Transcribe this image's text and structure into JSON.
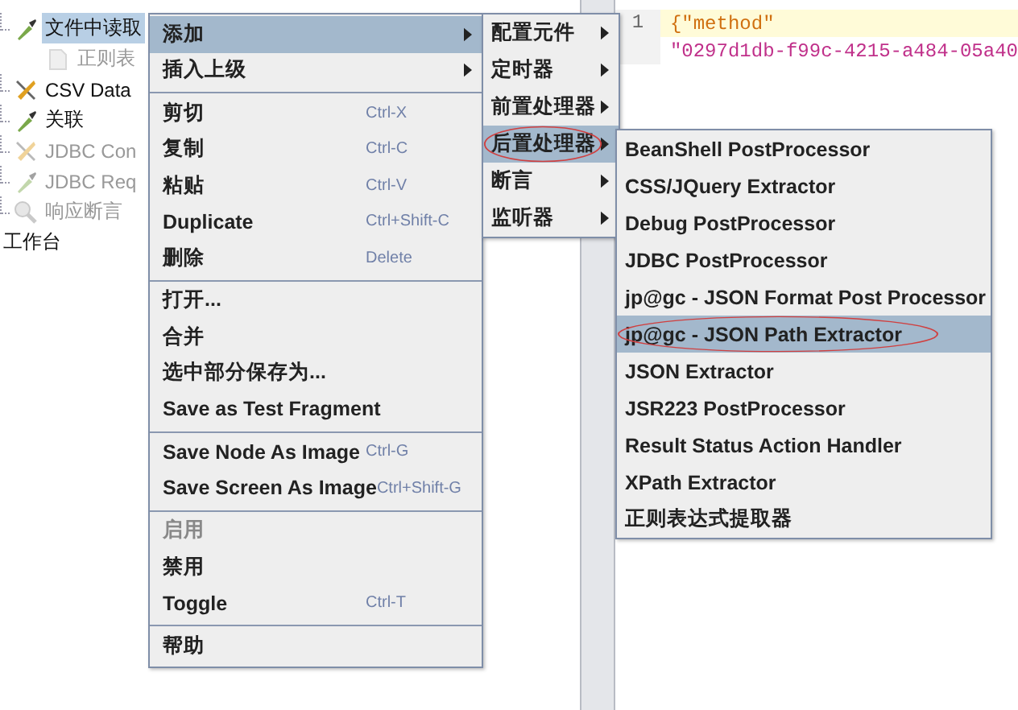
{
  "tree": {
    "items": [
      {
        "label": "文件中读取",
        "kind": "dropper",
        "selected": true,
        "disabled": false,
        "children": [
          {
            "label": "正则表",
            "kind": "page",
            "selected": false,
            "disabled": true
          }
        ]
      },
      {
        "label": "CSV Data",
        "kind": "tools",
        "selected": false,
        "disabled": false
      },
      {
        "label": "关联",
        "kind": "dropper",
        "selected": false,
        "disabled": false
      },
      {
        "label": "JDBC Con",
        "kind": "tools",
        "selected": false,
        "disabled": true
      },
      {
        "label": "JDBC Req",
        "kind": "dropper",
        "selected": false,
        "disabled": true
      },
      {
        "label": "响应断言",
        "kind": "magnifier",
        "selected": false,
        "disabled": true
      }
    ],
    "root": {
      "label": "工作台"
    }
  },
  "editor": {
    "lines": [
      {
        "number": "1",
        "parts": [
          {
            "kind": "key",
            "text": "{\"method\""
          }
        ],
        "current": true
      },
      {
        "parts": [
          {
            "kind": "string",
            "text": "\"0297d1db-f99c-4215-a484-05a40"
          }
        ],
        "current": false
      }
    ]
  },
  "menu": {
    "groups": [
      [
        {
          "label": "添加",
          "submenu": true,
          "selected": true,
          "disabled": false
        },
        {
          "label": "插入上级",
          "submenu": true,
          "selected": false,
          "disabled": false
        }
      ],
      [
        {
          "label": "剪切",
          "shortcut": "Ctrl-X",
          "submenu": false,
          "selected": false,
          "disabled": false
        },
        {
          "label": "复制",
          "shortcut": "Ctrl-C",
          "submenu": false,
          "selected": false,
          "disabled": false
        },
        {
          "label": "粘贴",
          "shortcut": "Ctrl-V",
          "submenu": false,
          "selected": false,
          "disabled": false
        },
        {
          "label": "Duplicate",
          "shortcut": "Ctrl+Shift-C",
          "submenu": false,
          "selected": false,
          "disabled": false
        },
        {
          "label": "删除",
          "shortcut": "Delete",
          "submenu": false,
          "selected": false,
          "disabled": false
        }
      ],
      [
        {
          "label": "打开...",
          "submenu": false,
          "selected": false,
          "disabled": false
        },
        {
          "label": "合并",
          "submenu": false,
          "selected": false,
          "disabled": false
        },
        {
          "label": "选中部分保存为...",
          "submenu": false,
          "selected": false,
          "disabled": false
        },
        {
          "label": "Save as Test Fragment",
          "submenu": false,
          "selected": false,
          "disabled": false
        }
      ],
      [
        {
          "label": "Save Node As Image",
          "shortcut": "Ctrl-G",
          "submenu": false,
          "selected": false,
          "disabled": false
        },
        {
          "label": "Save Screen As Image",
          "shortcut": "Ctrl+Shift-G",
          "submenu": false,
          "selected": false,
          "disabled": false
        }
      ],
      [
        {
          "label": "启用",
          "submenu": false,
          "selected": false,
          "disabled": true
        },
        {
          "label": "禁用",
          "submenu": false,
          "selected": false,
          "disabled": false
        },
        {
          "label": "Toggle",
          "shortcut": "Ctrl-T",
          "submenu": false,
          "selected": false,
          "disabled": false
        }
      ],
      [
        {
          "label": "帮助",
          "submenu": false,
          "selected": false,
          "disabled": false
        }
      ]
    ]
  },
  "submenu": {
    "items": [
      {
        "label": "配置元件",
        "selected": false,
        "circled": false
      },
      {
        "label": "定时器",
        "selected": false,
        "circled": false
      },
      {
        "label": "前置处理器",
        "selected": false,
        "circled": false
      },
      {
        "label": "后置处理器",
        "selected": true,
        "circled": true
      },
      {
        "label": "断言",
        "selected": false,
        "circled": false
      },
      {
        "label": "监听器",
        "selected": false,
        "circled": false
      }
    ]
  },
  "postprocessors": {
    "items": [
      {
        "label": "BeanShell PostProcessor",
        "selected": false,
        "circled": false
      },
      {
        "label": "CSS/JQuery Extractor",
        "selected": false,
        "circled": false
      },
      {
        "label": "Debug PostProcessor",
        "selected": false,
        "circled": false
      },
      {
        "label": "JDBC PostProcessor",
        "selected": false,
        "circled": false
      },
      {
        "label": "jp@gc - JSON Format Post Processor",
        "selected": false,
        "circled": false
      },
      {
        "label": "jp@gc - JSON Path Extractor",
        "selected": true,
        "circled": true
      },
      {
        "label": "JSON Extractor",
        "selected": false,
        "circled": false
      },
      {
        "label": "JSR223 PostProcessor",
        "selected": false,
        "circled": false
      },
      {
        "label": "Result Status Action Handler",
        "selected": false,
        "circled": false
      },
      {
        "label": "XPath Extractor",
        "selected": false,
        "circled": false
      },
      {
        "label": "正则表达式提取器",
        "selected": false,
        "circled": false
      }
    ]
  }
}
